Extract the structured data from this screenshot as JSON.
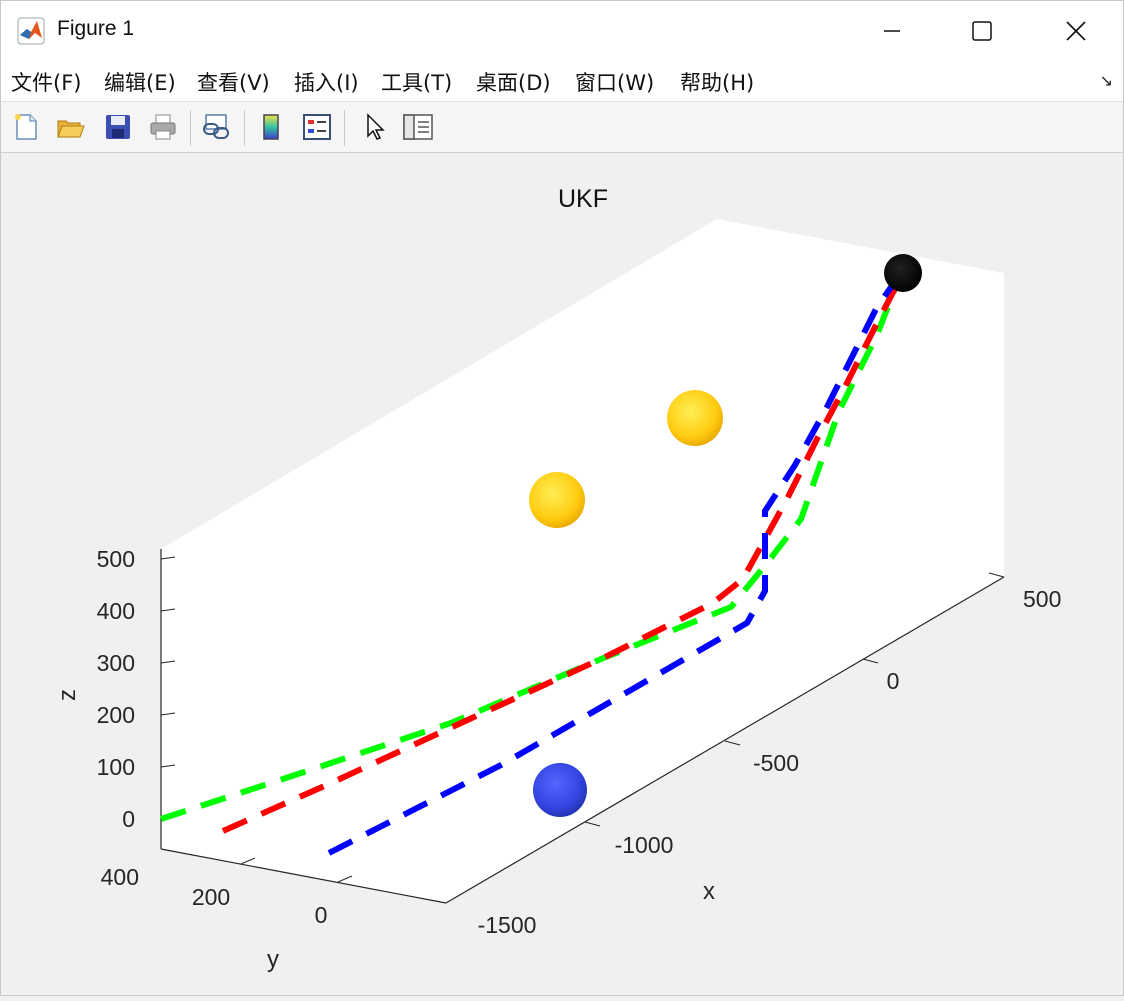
{
  "window": {
    "title": "Figure 1"
  },
  "menu": {
    "items": [
      "文件(F)",
      "编辑(E)",
      "查看(V)",
      "插入(I)",
      "工具(T)",
      "桌面(D)",
      "窗口(W)",
      "帮助(H)"
    ]
  },
  "toolbar": {
    "icons": [
      "new-figure-icon",
      "open-file-icon",
      "save-icon",
      "print-icon",
      "link-plot-icon",
      "colorbar-icon",
      "legend-icon",
      "pointer-icon",
      "property-editor-icon"
    ]
  },
  "chart_data": {
    "type": "line",
    "title": "UKF",
    "xlabel": "x",
    "ylabel": "y",
    "zlabel": "z",
    "x_ticks": [
      "500",
      "0",
      "-500",
      "-1000",
      "-1500"
    ],
    "y_ticks": [
      "400",
      "200",
      "0"
    ],
    "z_ticks": [
      "500",
      "400",
      "300",
      "200",
      "100",
      "0"
    ],
    "series": [
      {
        "color": "#00ff00",
        "style": "dashed"
      },
      {
        "color": "#ff0000",
        "style": "dashed"
      },
      {
        "color": "#0000ff",
        "style": "dashed"
      }
    ],
    "markers": [
      {
        "shape": "sphere",
        "color": "#000000"
      },
      {
        "shape": "sphere",
        "color": "#ffcc00"
      },
      {
        "shape": "sphere",
        "color": "#ffcc00"
      },
      {
        "shape": "sphere",
        "color": "#3344ee"
      }
    ]
  }
}
